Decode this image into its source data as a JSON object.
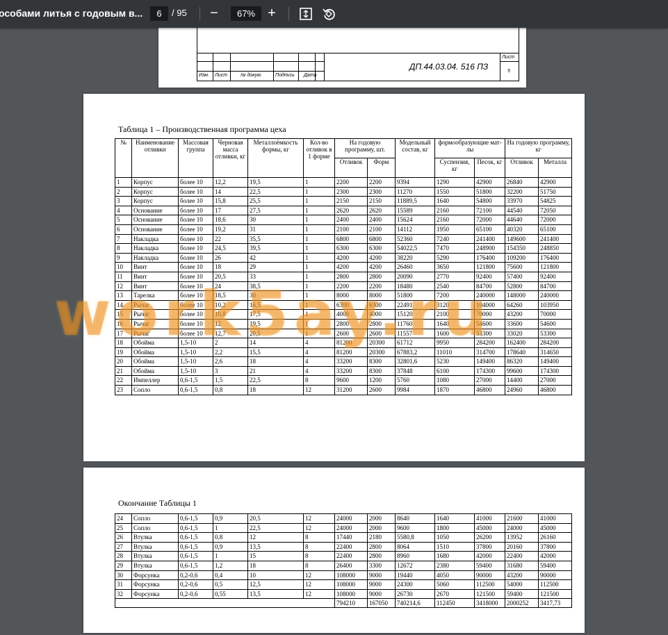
{
  "toolbar": {
    "title": "особами литья с годовым в...",
    "page": "6",
    "total": "/ 95",
    "zoom": "67%",
    "zoom_out": "−",
    "zoom_in": "+"
  },
  "stamp": {
    "list_label": "Лист",
    "list_num": "5",
    "izm": "Изм.",
    "list": "Лист",
    "ndoc": "№ докум.",
    "podpis": "Подпись",
    "data": "Дата",
    "doc": "ДП.44.03.04. 516 ПЗ"
  },
  "table1": {
    "caption": "Таблица 1 – Производственная программа цеха",
    "headers": {
      "num": "№",
      "name": "Наименование отливки",
      "mass_group": "Массовая группа",
      "rough_mass": "Черновая масса отливки, кг",
      "metal_cap": "Металлоёмкость формы, кг",
      "count": "Кол-во отливок в 1 форме",
      "annual": "На годовую программу, шт.",
      "annual_cast": "Отливок",
      "annual_form": "Форм",
      "model": "Модельный состав, кг",
      "molding": "формообразующие мат-лы",
      "molding_susp": "Суспензия, кг",
      "molding_sand": "Песок, кг",
      "annual_kg": "На годовую программу, кг",
      "kg_cast": "Отливок",
      "kg_metal": "Металла"
    },
    "rows": [
      [
        "1",
        "Корпус",
        "более 10",
        "12,2",
        "19,5",
        "1",
        "2200",
        "2200",
        "9394",
        "1290",
        "42900",
        "26840",
        "42900"
      ],
      [
        "2",
        "Корпус",
        "более 10",
        "14",
        "22,5",
        "1",
        "2300",
        "2300",
        "11270",
        "1550",
        "51800",
        "32200",
        "51750"
      ],
      [
        "3",
        "Корпус",
        "более 10",
        "15,8",
        "25,5",
        "1",
        "2150",
        "2150",
        "11889,5",
        "1640",
        "54800",
        "33970",
        "54825"
      ],
      [
        "4",
        "Основание",
        "более 10",
        "17",
        "27,5",
        "1",
        "2620",
        "2620",
        "15589",
        "2160",
        "72100",
        "44540",
        "72050"
      ],
      [
        "5",
        "Основание",
        "более 10",
        "18,6",
        "30",
        "1",
        "2400",
        "2400",
        "15624",
        "2160",
        "72000",
        "44640",
        "72000"
      ],
      [
        "6",
        "Основание",
        "более 10",
        "19,2",
        "31",
        "1",
        "2100",
        "2100",
        "14112",
        "1950",
        "65100",
        "40320",
        "65100"
      ],
      [
        "7",
        "Накладка",
        "более 10",
        "22",
        "35,5",
        "1",
        "6800",
        "6800",
        "52360",
        "7240",
        "241400",
        "149600",
        "241400"
      ],
      [
        "8",
        "Накладка",
        "более 10",
        "24,5",
        "39,5",
        "1",
        "6300",
        "6300",
        "54022,5",
        "7470",
        "248900",
        "154350",
        "248850"
      ],
      [
        "9",
        "Накладка",
        "более 10",
        "26",
        "42",
        "1",
        "4200",
        "4200",
        "38220",
        "5290",
        "176400",
        "109200",
        "176400"
      ],
      [
        "10",
        "Винт",
        "более 10",
        "18",
        "29",
        "1",
        "4200",
        "4200",
        "26460",
        "3650",
        "121800",
        "75600",
        "121800"
      ],
      [
        "11",
        "Винт",
        "более 10",
        "20,5",
        "33",
        "1",
        "2800",
        "2800",
        "20090",
        "2770",
        "92400",
        "57400",
        "92400"
      ],
      [
        "12",
        "Винт",
        "более 10",
        "24",
        "38,5",
        "1",
        "2200",
        "2200",
        "18480",
        "2540",
        "84700",
        "52800",
        "84700"
      ],
      [
        "13",
        "Тарелка",
        "более 10",
        "18,5",
        "30",
        "1",
        "8000",
        "8000",
        "51800",
        "7200",
        "240000",
        "148000",
        "240000"
      ],
      [
        "14",
        "Рычаг",
        "более 10",
        "10,2",
        "16,5",
        "1",
        "6300",
        "6300",
        "22491",
        "3120",
        "104000",
        "64260",
        "103950"
      ],
      [
        "15",
        "Рычаг",
        "более 10",
        "10,8",
        "17,5",
        "1",
        "4000",
        "4000",
        "15120",
        "2100",
        "70000",
        "43200",
        "70000"
      ],
      [
        "16",
        "Рычаг",
        "более 10",
        "12",
        "19,5",
        "1",
        "2800",
        "2800",
        "11760",
        "1640",
        "54600",
        "33600",
        "54600"
      ],
      [
        "17",
        "Рычаг",
        "более 10",
        "12,7",
        "20,5",
        "1",
        "2600",
        "2600",
        "11557",
        "1600",
        "53300",
        "33020",
        "53300"
      ],
      [
        "18",
        "Обойма",
        "1,5-10",
        "2",
        "14",
        "4",
        "81200",
        "20300",
        "61712",
        "9950",
        "284200",
        "162400",
        "284200"
      ],
      [
        "19",
        "Обойма",
        "1,5-10",
        "2,2",
        "15,5",
        "4",
        "81200",
        "20300",
        "67883,2",
        "11010",
        "314700",
        "178640",
        "314650"
      ],
      [
        "20",
        "Обойма",
        "1,5-10",
        "2,6",
        "18",
        "4",
        "33200",
        "8300",
        "32801,6",
        "5230",
        "149400",
        "86320",
        "149400"
      ],
      [
        "21",
        "Обойма",
        "1,5-10",
        "3",
        "21",
        "4",
        "33200",
        "8300",
        "37848",
        "6100",
        "174300",
        "99600",
        "174300"
      ],
      [
        "22",
        "Импеллер",
        "0,6-1,5",
        "1,5",
        "22,5",
        "8",
        "9600",
        "1200",
        "5760",
        "1080",
        "27000",
        "14400",
        "27000"
      ],
      [
        "23",
        "Сопло",
        "0,6-1,5",
        "0,8",
        "18",
        "12",
        "31200",
        "2600",
        "9984",
        "1870",
        "46800",
        "24960",
        "46800"
      ]
    ]
  },
  "table2": {
    "caption": "Окончание Таблицы 1",
    "rows": [
      [
        "24",
        "Сопло",
        "0,6-1,5",
        "0,9",
        "20,5",
        "12",
        "24000",
        "2000",
        "8640",
        "1640",
        "41000",
        "21600",
        "41000"
      ],
      [
        "25",
        "Сопло",
        "0,6-1,5",
        "1",
        "22,5",
        "12",
        "24000",
        "2000",
        "9600",
        "1800",
        "45000",
        "24000",
        "45000"
      ],
      [
        "26",
        "Втулка",
        "0,6-1,5",
        "0,8",
        "12",
        "8",
        "17440",
        "2180",
        "5580,8",
        "1050",
        "26200",
        "13952",
        "26160"
      ],
      [
        "27",
        "Втулка",
        "0,6-1,5",
        "0,9",
        "13,5",
        "8",
        "22400",
        "2800",
        "8064",
        "1510",
        "37800",
        "20160",
        "37800"
      ],
      [
        "28",
        "Втулка",
        "0,6-1,5",
        "1",
        "15",
        "8",
        "22400",
        "2800",
        "8960",
        "1680",
        "42000",
        "22400",
        "42000"
      ],
      [
        "29",
        "Втулка",
        "0,6-1,5",
        "1,2",
        "18",
        "8",
        "26400",
        "3300",
        "12672",
        "2380",
        "59400",
        "31680",
        "59400"
      ],
      [
        "30",
        "Форсунка",
        "0,2-0,6",
        "0,4",
        "10",
        "12",
        "108000",
        "9000",
        "19440",
        "4050",
        "90000",
        "43200",
        "90000"
      ],
      [
        "31",
        "Форсунка",
        "0,2-0,6",
        "0,5",
        "12,5",
        "12",
        "108000",
        "9000",
        "24300",
        "5060",
        "112500",
        "54000",
        "112500"
      ],
      [
        "32",
        "Форсунка",
        "0,2-0,6",
        "0,55",
        "13,5",
        "12",
        "108000",
        "9000",
        "26730",
        "2670",
        "121500",
        "59400",
        "121500"
      ]
    ],
    "totals": [
      "794210",
      "167050",
      "740214,6",
      "112450",
      "3418000",
      "2000252",
      "3417,73"
    ]
  },
  "watermark": "work5ay.ru"
}
